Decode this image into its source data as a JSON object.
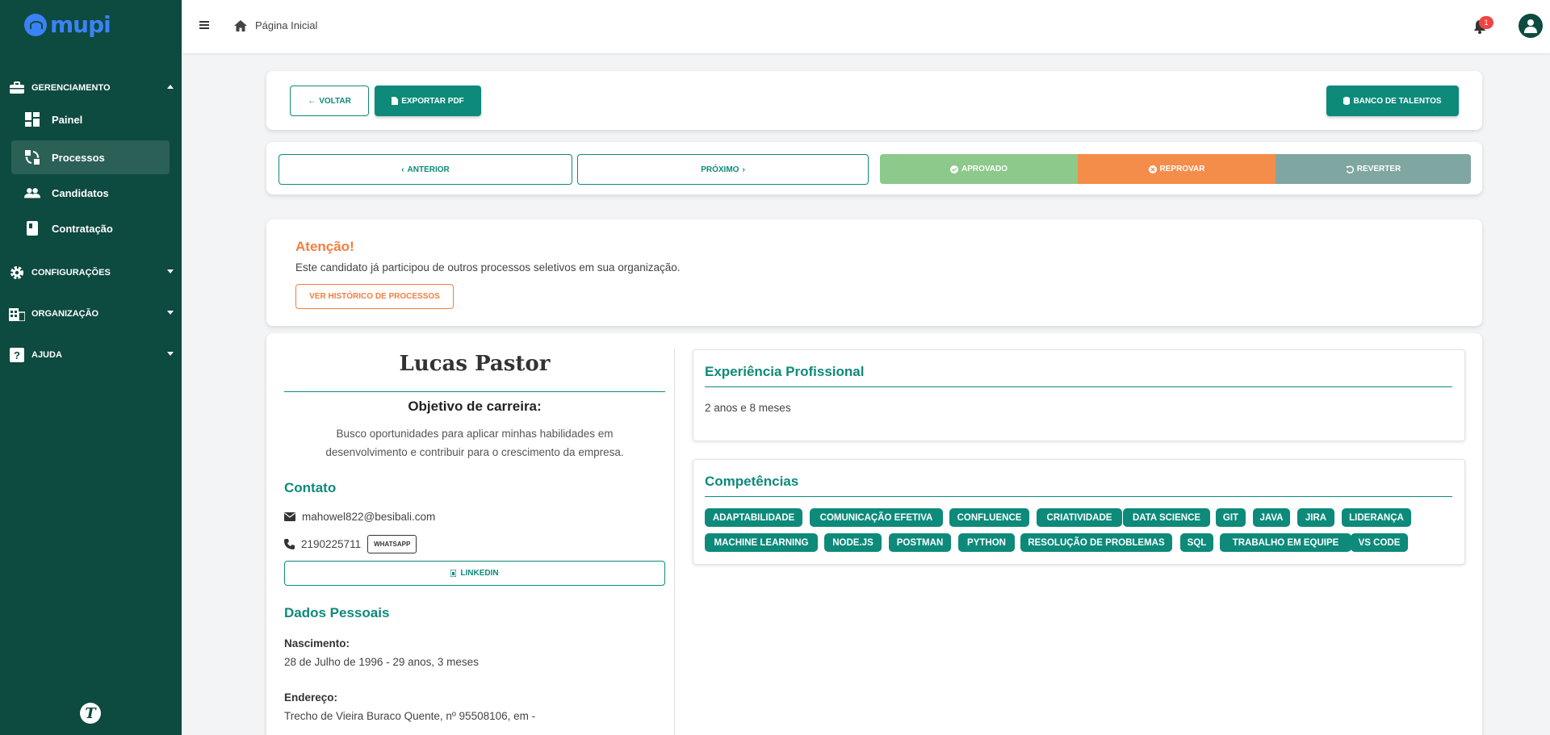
{
  "app": {
    "logo_text": "mupi",
    "bottom_logo_letter": "T"
  },
  "sidebar": {
    "groups": [
      {
        "label": "GERENCIAMENTO",
        "icon": "briefcase-icon",
        "expanded": true
      },
      {
        "label": "CONFIGURAÇÕES",
        "icon": "gear-icon",
        "expanded": false
      },
      {
        "label": "ORGANIZAÇÃO",
        "icon": "building-icon",
        "expanded": false
      },
      {
        "label": "AJUDA",
        "icon": "help-icon",
        "expanded": false
      }
    ],
    "items": [
      {
        "label": "Painel",
        "icon": "dashboard-icon",
        "active": false
      },
      {
        "label": "Processos",
        "icon": "processes-icon",
        "active": true
      },
      {
        "label": "Candidatos",
        "icon": "people-icon",
        "active": false
      },
      {
        "label": "Contratação",
        "icon": "contract-icon",
        "active": false
      }
    ]
  },
  "topbar": {
    "breadcrumb": "Página Inicial",
    "notifications_count": "1"
  },
  "toolbar": {
    "back": "VOLTAR",
    "export_pdf": "EXPORTAR PDF",
    "talent_bank": "BANCO DE TALENTOS"
  },
  "nav": {
    "previous": "ANTERIOR",
    "next": "PRÓXIMO",
    "approved": "APROVADO",
    "reject": "REPROVAR",
    "revert": "REVERTER"
  },
  "alert": {
    "title": "Atenção!",
    "text": "Este candidato já participou de outros processos seletivos em sua organização.",
    "button": "VER HISTÓRICO DE PROCESSOS"
  },
  "candidate": {
    "name": "Lucas Pastor",
    "objective_title": "Objetivo de carreira:",
    "objective_line1": "Busco oportunidades para aplicar minhas habilidades em",
    "objective_line2": "desenvolvimento e contribuir para o crescimento da empresa.",
    "contact_title": "Contato",
    "email": "mahowel822@besibali.com",
    "phone": "2190225711",
    "whatsapp": "WHATSAPP",
    "linkedin": "LINKEDIN",
    "personal_title": "Dados Pessoais",
    "birth_label": "Nascimento:",
    "birth_value": "28 de Julho de 1996 - 29 anos, 3 meses",
    "address_label": "Endereço:",
    "address_value": "Trecho de Vieira Buraco Quente, nº 95508106, em -"
  },
  "experience": {
    "title": "Experiência Profissional",
    "value": "2 anos e 8 meses"
  },
  "skills": {
    "title": "Competências",
    "row1": [
      "ADAPTABILIDADE",
      "COMUNICAÇÃO EFETIVA",
      "CONFLUENCE",
      "CRIATIVIDADE",
      "DATA SCIENCE",
      "GIT",
      "JAVA",
      "JIRA",
      "LIDERANÇA"
    ],
    "row2": [
      "MACHINE LEARNING",
      "NODE.JS",
      "POSTMAN",
      "PYTHON",
      "RESOLUÇÃO DE PROBLEMAS",
      "SQL",
      "TRABALHO EM EQUIPE",
      "VS CODE"
    ]
  },
  "colors": {
    "sidebar": "#0d4a3f",
    "primary": "#0d8a7a",
    "approved": "#8cc98a",
    "reject": "#f58d4a",
    "revert": "#7fa6a0",
    "warning": "#f47e3e"
  }
}
